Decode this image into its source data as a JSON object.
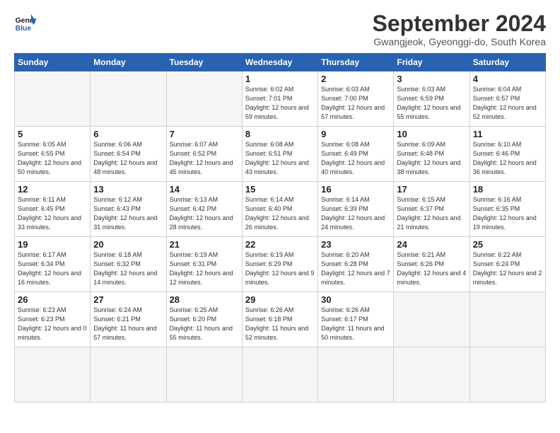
{
  "logo": {
    "line1": "General",
    "line2": "Blue"
  },
  "title": "September 2024",
  "subtitle": "Gwangjeok, Gyeonggi-do, South Korea",
  "weekdays": [
    "Sunday",
    "Monday",
    "Tuesday",
    "Wednesday",
    "Thursday",
    "Friday",
    "Saturday"
  ],
  "days": [
    {
      "num": "",
      "sunrise": "",
      "sunset": "",
      "daylight": ""
    },
    {
      "num": "",
      "sunrise": "",
      "sunset": "",
      "daylight": ""
    },
    {
      "num": "",
      "sunrise": "",
      "sunset": "",
      "daylight": ""
    },
    {
      "num": "1",
      "sunrise": "Sunrise: 6:02 AM",
      "sunset": "Sunset: 7:01 PM",
      "daylight": "Daylight: 12 hours and 59 minutes."
    },
    {
      "num": "2",
      "sunrise": "Sunrise: 6:03 AM",
      "sunset": "Sunset: 7:00 PM",
      "daylight": "Daylight: 12 hours and 57 minutes."
    },
    {
      "num": "3",
      "sunrise": "Sunrise: 6:03 AM",
      "sunset": "Sunset: 6:59 PM",
      "daylight": "Daylight: 12 hours and 55 minutes."
    },
    {
      "num": "4",
      "sunrise": "Sunrise: 6:04 AM",
      "sunset": "Sunset: 6:57 PM",
      "daylight": "Daylight: 12 hours and 52 minutes."
    },
    {
      "num": "5",
      "sunrise": "Sunrise: 6:05 AM",
      "sunset": "Sunset: 6:55 PM",
      "daylight": "Daylight: 12 hours and 50 minutes."
    },
    {
      "num": "6",
      "sunrise": "Sunrise: 6:06 AM",
      "sunset": "Sunset: 6:54 PM",
      "daylight": "Daylight: 12 hours and 48 minutes."
    },
    {
      "num": "7",
      "sunrise": "Sunrise: 6:07 AM",
      "sunset": "Sunset: 6:52 PM",
      "daylight": "Daylight: 12 hours and 45 minutes."
    },
    {
      "num": "8",
      "sunrise": "Sunrise: 6:08 AM",
      "sunset": "Sunset: 6:51 PM",
      "daylight": "Daylight: 12 hours and 43 minutes."
    },
    {
      "num": "9",
      "sunrise": "Sunrise: 6:08 AM",
      "sunset": "Sunset: 6:49 PM",
      "daylight": "Daylight: 12 hours and 40 minutes."
    },
    {
      "num": "10",
      "sunrise": "Sunrise: 6:09 AM",
      "sunset": "Sunset: 6:48 PM",
      "daylight": "Daylight: 12 hours and 38 minutes."
    },
    {
      "num": "11",
      "sunrise": "Sunrise: 6:10 AM",
      "sunset": "Sunset: 6:46 PM",
      "daylight": "Daylight: 12 hours and 36 minutes."
    },
    {
      "num": "12",
      "sunrise": "Sunrise: 6:11 AM",
      "sunset": "Sunset: 6:45 PM",
      "daylight": "Daylight: 12 hours and 33 minutes."
    },
    {
      "num": "13",
      "sunrise": "Sunrise: 6:12 AM",
      "sunset": "Sunset: 6:43 PM",
      "daylight": "Daylight: 12 hours and 31 minutes."
    },
    {
      "num": "14",
      "sunrise": "Sunrise: 6:13 AM",
      "sunset": "Sunset: 6:42 PM",
      "daylight": "Daylight: 12 hours and 28 minutes."
    },
    {
      "num": "15",
      "sunrise": "Sunrise: 6:14 AM",
      "sunset": "Sunset: 6:40 PM",
      "daylight": "Daylight: 12 hours and 26 minutes."
    },
    {
      "num": "16",
      "sunrise": "Sunrise: 6:14 AM",
      "sunset": "Sunset: 6:39 PM",
      "daylight": "Daylight: 12 hours and 24 minutes."
    },
    {
      "num": "17",
      "sunrise": "Sunrise: 6:15 AM",
      "sunset": "Sunset: 6:37 PM",
      "daylight": "Daylight: 12 hours and 21 minutes."
    },
    {
      "num": "18",
      "sunrise": "Sunrise: 6:16 AM",
      "sunset": "Sunset: 6:35 PM",
      "daylight": "Daylight: 12 hours and 19 minutes."
    },
    {
      "num": "19",
      "sunrise": "Sunrise: 6:17 AM",
      "sunset": "Sunset: 6:34 PM",
      "daylight": "Daylight: 12 hours and 16 minutes."
    },
    {
      "num": "20",
      "sunrise": "Sunrise: 6:18 AM",
      "sunset": "Sunset: 6:32 PM",
      "daylight": "Daylight: 12 hours and 14 minutes."
    },
    {
      "num": "21",
      "sunrise": "Sunrise: 6:19 AM",
      "sunset": "Sunset: 6:31 PM",
      "daylight": "Daylight: 12 hours and 12 minutes."
    },
    {
      "num": "22",
      "sunrise": "Sunrise: 6:19 AM",
      "sunset": "Sunset: 6:29 PM",
      "daylight": "Daylight: 12 hours and 9 minutes."
    },
    {
      "num": "23",
      "sunrise": "Sunrise: 6:20 AM",
      "sunset": "Sunset: 6:28 PM",
      "daylight": "Daylight: 12 hours and 7 minutes."
    },
    {
      "num": "24",
      "sunrise": "Sunrise: 6:21 AM",
      "sunset": "Sunset: 6:26 PM",
      "daylight": "Daylight: 12 hours and 4 minutes."
    },
    {
      "num": "25",
      "sunrise": "Sunrise: 6:22 AM",
      "sunset": "Sunset: 6:24 PM",
      "daylight": "Daylight: 12 hours and 2 minutes."
    },
    {
      "num": "26",
      "sunrise": "Sunrise: 6:23 AM",
      "sunset": "Sunset: 6:23 PM",
      "daylight": "Daylight: 12 hours and 0 minutes."
    },
    {
      "num": "27",
      "sunrise": "Sunrise: 6:24 AM",
      "sunset": "Sunset: 6:21 PM",
      "daylight": "Daylight: 11 hours and 57 minutes."
    },
    {
      "num": "28",
      "sunrise": "Sunrise: 6:25 AM",
      "sunset": "Sunset: 6:20 PM",
      "daylight": "Daylight: 11 hours and 55 minutes."
    },
    {
      "num": "29",
      "sunrise": "Sunrise: 6:26 AM",
      "sunset": "Sunset: 6:18 PM",
      "daylight": "Daylight: 11 hours and 52 minutes."
    },
    {
      "num": "30",
      "sunrise": "Sunrise: 6:26 AM",
      "sunset": "Sunset: 6:17 PM",
      "daylight": "Daylight: 11 hours and 50 minutes."
    },
    {
      "num": "",
      "sunrise": "",
      "sunset": "",
      "daylight": ""
    },
    {
      "num": "",
      "sunrise": "",
      "sunset": "",
      "daylight": ""
    },
    {
      "num": "",
      "sunrise": "",
      "sunset": "",
      "daylight": ""
    },
    {
      "num": "",
      "sunrise": "",
      "sunset": "",
      "daylight": ""
    },
    {
      "num": "",
      "sunrise": "",
      "sunset": "",
      "daylight": ""
    }
  ]
}
